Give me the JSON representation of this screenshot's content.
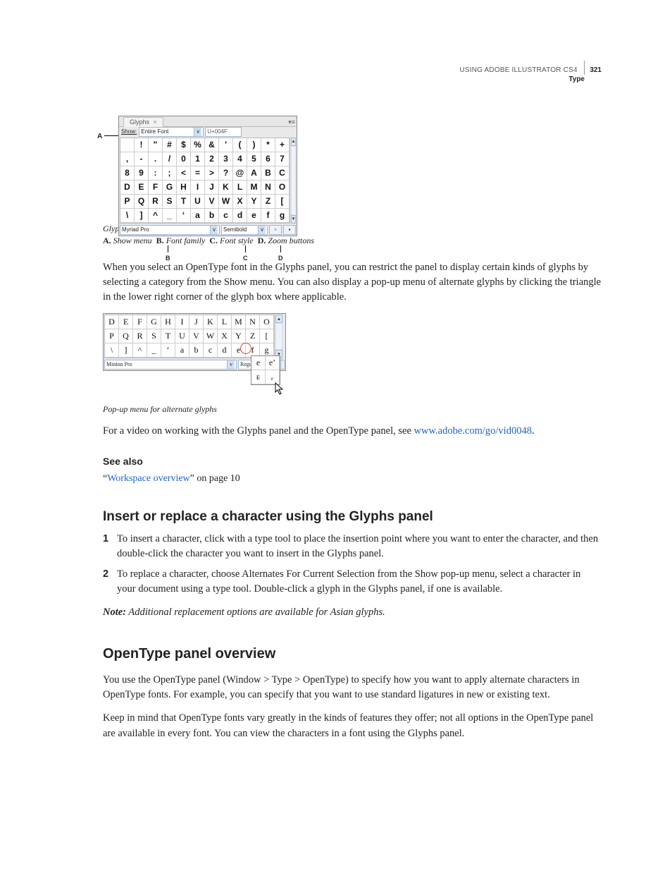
{
  "header": {
    "book": "USING ADOBE ILLUSTRATOR CS4",
    "page_number": "321",
    "section": "Type"
  },
  "figure1": {
    "leader_A": "A",
    "tab_label": "Glyphs",
    "tab_close": "×",
    "show_label": "Show:",
    "show_value": "Entire Font",
    "unicode_box": "U+004F",
    "rows": [
      [
        "",
        "!",
        "\"",
        "#",
        "$",
        "%",
        "&",
        "'",
        "(",
        ")",
        "*",
        "+"
      ],
      [
        ",",
        "-",
        ".",
        "/",
        "0",
        "1",
        "2",
        "3",
        "4",
        "5",
        "6",
        "7"
      ],
      [
        "8",
        "9",
        ":",
        ";",
        "<",
        "=",
        ">",
        "?",
        "@",
        "A",
        "B",
        "C"
      ],
      [
        "D",
        "E",
        "F",
        "G",
        "H",
        "I",
        "J",
        "K",
        "L",
        "M",
        "N",
        "O"
      ],
      [
        "P",
        "Q",
        "R",
        "S",
        "T",
        "U",
        "V",
        "W",
        "X",
        "Y",
        "Z",
        "["
      ],
      [
        "\\",
        "]",
        "^",
        "_",
        "‘",
        "a",
        "b",
        "c",
        "d",
        "e",
        "f",
        "g"
      ]
    ],
    "font_family": "Myriad Pro",
    "font_style": "Semibold",
    "callouts": {
      "B": "B",
      "C": "C",
      "D": "D"
    },
    "caption": "Glyphs panel",
    "legend": [
      {
        "key": "A.",
        "label": "Show menu"
      },
      {
        "key": "B.",
        "label": "Font family"
      },
      {
        "key": "C.",
        "label": "Font style"
      },
      {
        "key": "D.",
        "label": "Zoom buttons"
      }
    ]
  },
  "para1": "When you select an OpenType font in the Glyphs panel, you can restrict the panel to display certain kinds of glyphs by selecting a category from the Show menu. You can also display a pop-up menu of alternate glyphs by clicking the triangle in the lower right corner of the glyph box where applicable.",
  "figure2": {
    "rows": [
      [
        "D",
        "E",
        "F",
        "G",
        "H",
        "I",
        "J",
        "K",
        "L",
        "M",
        "N",
        "O"
      ],
      [
        "P",
        "Q",
        "R",
        "S",
        "T",
        "U",
        "V",
        "W",
        "X",
        "Y",
        "Z",
        "["
      ],
      [
        "\\",
        "]",
        "^",
        "_",
        "‘",
        "a",
        "b",
        "c",
        "d",
        "e",
        "f",
        "g"
      ]
    ],
    "font_family": "Minion Pro",
    "font_style": "Regular",
    "popup": [
      [
        "e",
        "eʼ"
      ],
      [
        "ᴇ",
        "ₑ"
      ]
    ],
    "caption": "Pop-up menu for alternate glyphs"
  },
  "para2_a": "For a video on working with the Glyphs panel and the OpenType panel, see ",
  "para2_link": "www.adobe.com/go/vid0048",
  "para2_b": ".",
  "seealso_heading": "See also",
  "seealso_link": "Workspace overview",
  "seealso_quote_open": "“",
  "seealso_quote_close": "”",
  "seealso_tail": " on page 10",
  "h_insert": "Insert or replace a character using the Glyphs panel",
  "steps": [
    "To insert a character, click with a type tool to place the insertion point where you want to enter the character, and then double-click the character you want to insert in the Glyphs panel.",
    "To replace a character, choose Alternates For Current Selection from the Show pop-up menu, select a character in your document using a type tool. Double-click a glyph in the Glyphs panel, if one is available."
  ],
  "note_label": "Note:",
  "note_text": " Additional replacement options are available for Asian glyphs.",
  "h_opentype": "OpenType panel overview",
  "ot_para": "You use the OpenType panel (Window > Type > OpenType) to specify how you want to apply alternate characters in OpenType fonts. For example, you can specify that you want to use standard ligatures in new or existing text.",
  "ot_para2": "Keep in mind that OpenType fonts vary greatly in the kinds of features they offer; not all options in the OpenType panel are available in every font. You can view the characters in a font using the Glyphs panel."
}
